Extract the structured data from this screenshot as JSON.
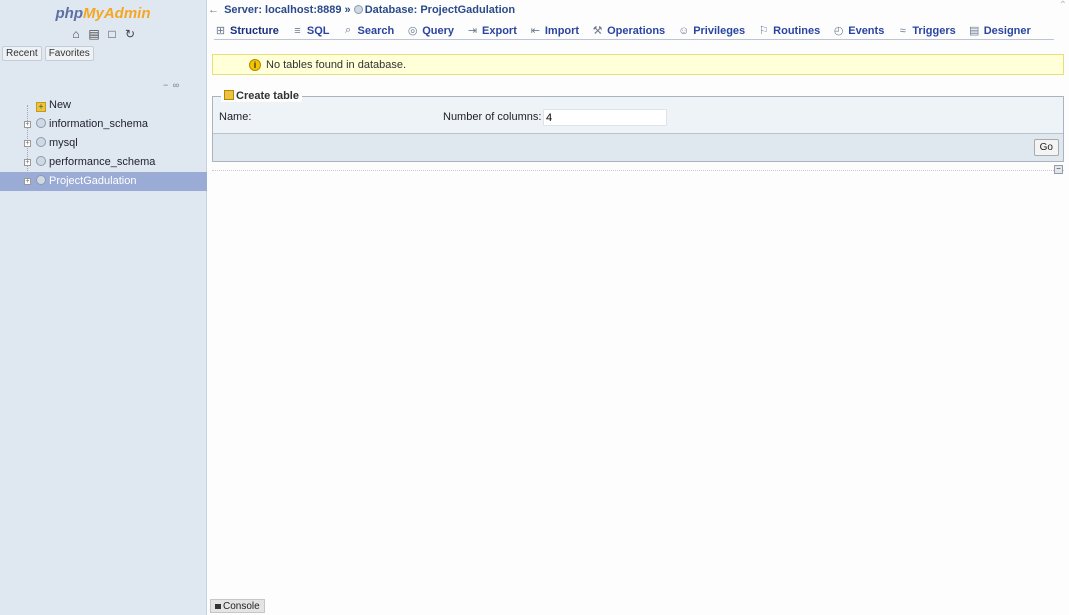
{
  "logo": {
    "part1": "php",
    "part2": "MyAdmin"
  },
  "nav": {
    "icons": [
      "home-icon",
      "docs-icon",
      "sql-docs-icon",
      "reload-icon"
    ],
    "recent_label": "Recent",
    "favorites_label": "Favorites",
    "collapse_glyph": "− ∞",
    "tree": [
      {
        "label": "New",
        "kind": "new",
        "selected": false
      },
      {
        "label": "information_schema",
        "kind": "db",
        "selected": false
      },
      {
        "label": "mysql",
        "kind": "db",
        "selected": false
      },
      {
        "label": "performance_schema",
        "kind": "db",
        "selected": false
      },
      {
        "label": "ProjectGadulation",
        "kind": "db",
        "selected": true
      }
    ]
  },
  "breadcrumb": {
    "server": "Server: localhost:8889",
    "separator": "»",
    "database": "Database: ProjectGadulation"
  },
  "tabs": [
    {
      "label": "Structure",
      "icon": "structure-icon",
      "glyph": "⊞"
    },
    {
      "label": "SQL",
      "icon": "sql-icon",
      "glyph": "≡"
    },
    {
      "label": "Search",
      "icon": "search-icon",
      "glyph": "⌕"
    },
    {
      "label": "Query",
      "icon": "query-icon",
      "glyph": "◎"
    },
    {
      "label": "Export",
      "icon": "export-icon",
      "glyph": "⇥"
    },
    {
      "label": "Import",
      "icon": "import-icon",
      "glyph": "⇤"
    },
    {
      "label": "Operations",
      "icon": "operations-icon",
      "glyph": "⚒"
    },
    {
      "label": "Privileges",
      "icon": "privileges-icon",
      "glyph": "☺"
    },
    {
      "label": "Routines",
      "icon": "routines-icon",
      "glyph": "⚐"
    },
    {
      "label": "Events",
      "icon": "events-icon",
      "glyph": "◴"
    },
    {
      "label": "Triggers",
      "icon": "triggers-icon",
      "glyph": "≈"
    },
    {
      "label": "Designer",
      "icon": "designer-icon",
      "glyph": "▤"
    }
  ],
  "notice": {
    "text": "No tables found in database.",
    "icon": "info-icon"
  },
  "create_table": {
    "legend": "Create table",
    "name_label": "Name:",
    "name_value": "",
    "columns_label": "Number of columns:",
    "columns_value": "4",
    "go_label": "Go"
  },
  "console_label": "Console",
  "colors": {
    "nav_bg": "#dfe8f1",
    "selected_bg": "#9aabd6",
    "link": "#2a45a0",
    "notice_bg": "#ffffd8"
  }
}
